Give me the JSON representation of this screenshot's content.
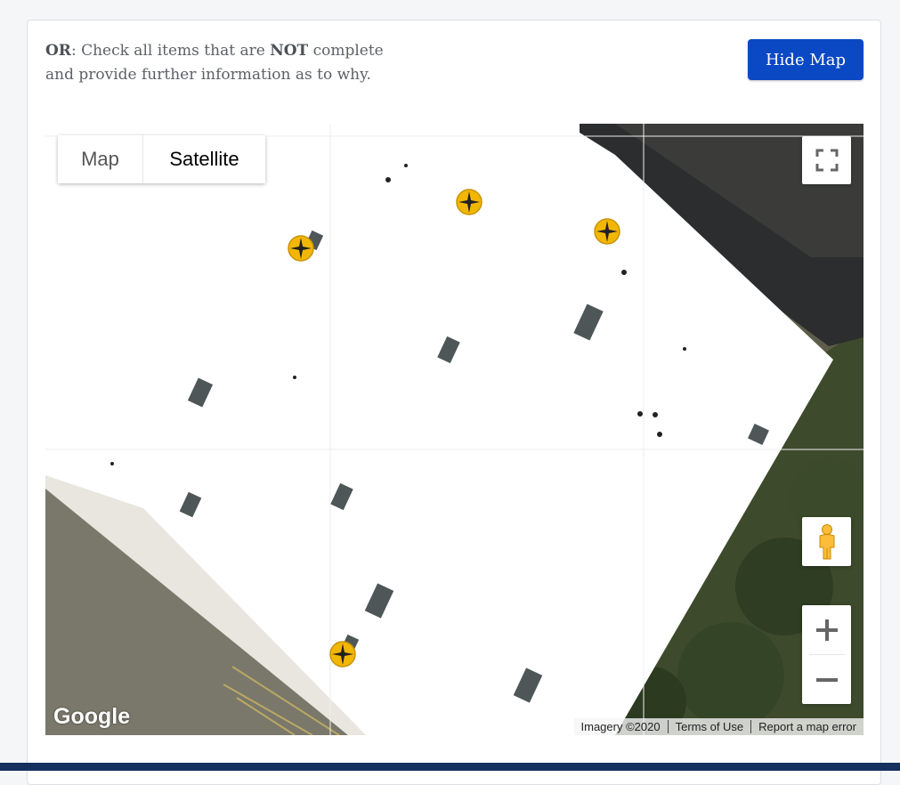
{
  "instructions": {
    "prefix_bold": "OR",
    "line_part1": ": Check all items that are ",
    "emphasis": "NOT",
    "line_part2": " complete",
    "line2": "and provide further information as to why."
  },
  "buttons": {
    "hide_map": "Hide Map"
  },
  "map": {
    "type_control": {
      "map_label": "Map",
      "satellite_label": "Satellite",
      "selected": "Satellite"
    },
    "logo": "Google",
    "attribution": {
      "imagery": "Imagery ©2020",
      "terms": "Terms of Use",
      "report": "Report a map error"
    },
    "markers": [
      {
        "name": "roof-marker-1",
        "icon": "crosshair-marker-icon"
      },
      {
        "name": "roof-marker-2",
        "icon": "crosshair-marker-icon"
      },
      {
        "name": "roof-marker-3",
        "icon": "crosshair-marker-icon"
      },
      {
        "name": "roof-marker-4",
        "icon": "crosshair-marker-icon"
      }
    ],
    "controls": [
      "fullscreen-icon",
      "pegman-icon",
      "zoom-in-icon",
      "zoom-out-icon"
    ]
  },
  "colors": {
    "accent": "#0b48c4",
    "marker": "#f2b705",
    "footer": "#15305f"
  }
}
